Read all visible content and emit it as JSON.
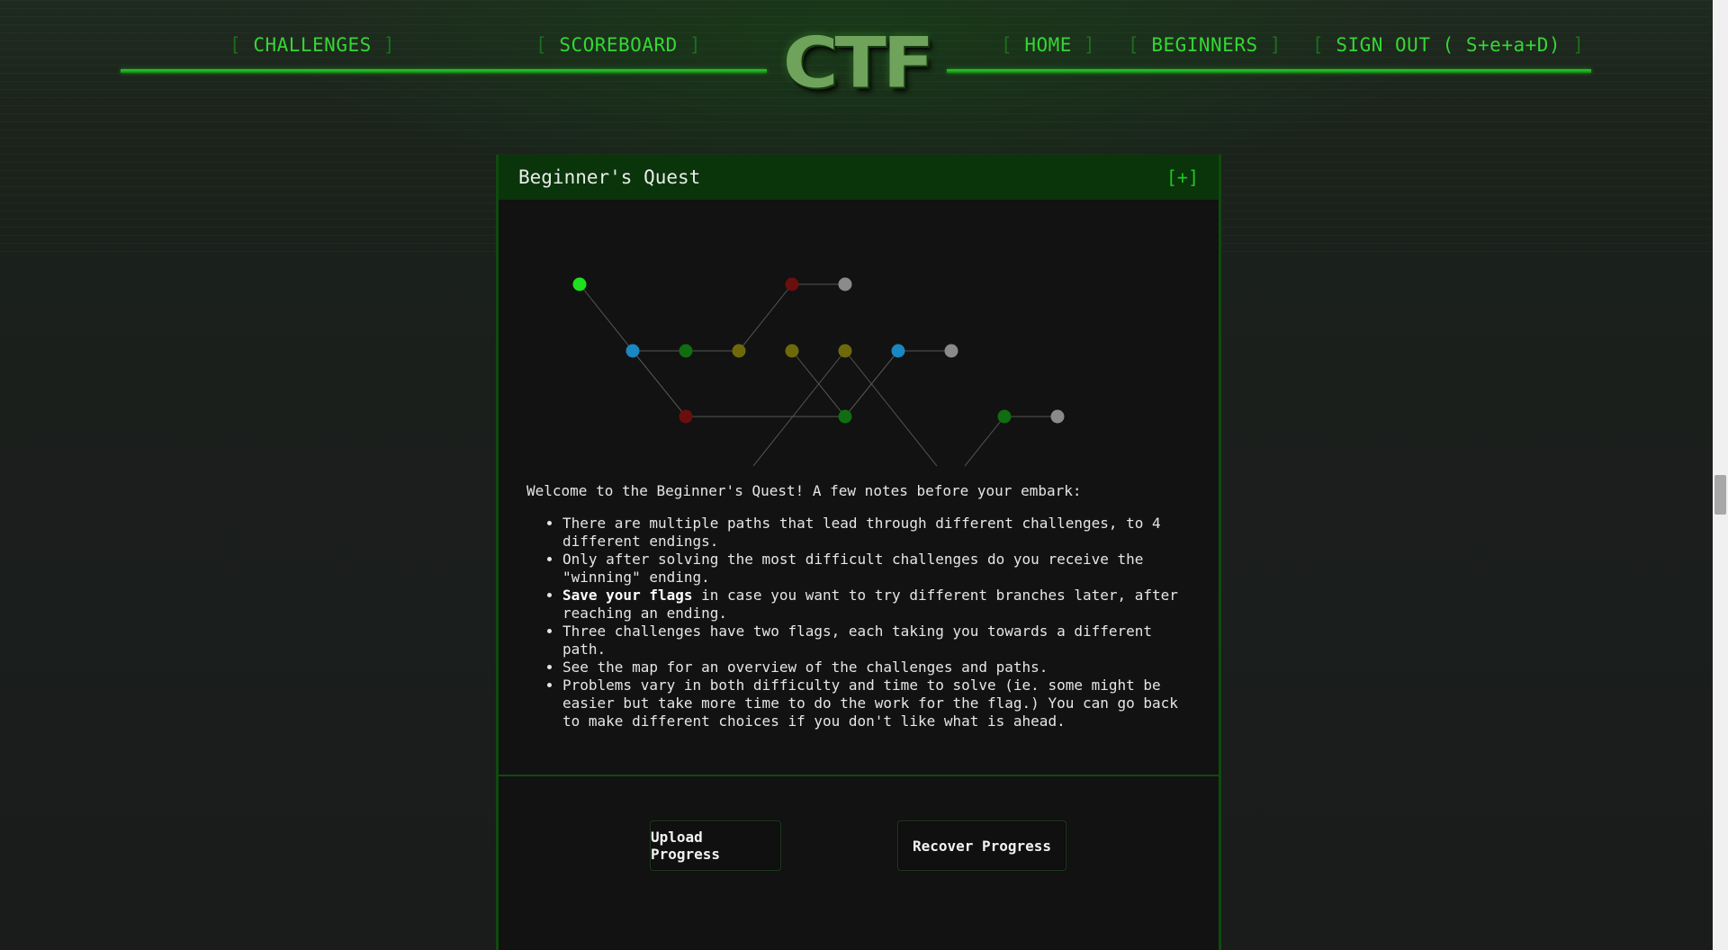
{
  "nav": {
    "links": [
      {
        "label": "CHALLENGES"
      },
      {
        "label": "SCOREBOARD"
      },
      {
        "label": "HOME"
      },
      {
        "label": "BEGINNERS"
      },
      {
        "label": "SIGN OUT ( S+e+a+D)"
      }
    ],
    "bracket_open": "[",
    "bracket_close": "]",
    "logo_text": "CTF"
  },
  "panel": {
    "title": "Beginner's Quest",
    "toggle": "[+]"
  },
  "map": {
    "colors": {
      "start": "#1fe01f",
      "blue": "#1a86c2",
      "green": "#106d10",
      "olive": "#6e6a0c",
      "red": "#6b0e0e",
      "grey": "#8a8a8a",
      "edge": "#555855"
    }
  },
  "intro": {
    "lead": "Welcome to the Beginner's Quest! A few notes before your embark:",
    "items": [
      {
        "bold": "",
        "text": "There are multiple paths that lead through different challenges, to 4 different endings."
      },
      {
        "bold": "",
        "text": "Only after solving the most difficult challenges do you receive the \"winning\" ending."
      },
      {
        "bold": "Save your flags",
        "text": " in case you want to try different branches later, after reaching an ending."
      },
      {
        "bold": "",
        "text": "Three challenges have two flags, each taking you towards a different path."
      },
      {
        "bold": "",
        "text": "See the map for an overview of the challenges and paths."
      },
      {
        "bold": "",
        "text": "Problems vary in both difficulty and time to solve (ie. some might be easier but take more time to do the work for the flag.) You can go back to make different choices if you don't like what is ahead."
      }
    ]
  },
  "buttons": {
    "upload": "Upload Progress",
    "recover": "Recover Progress"
  }
}
